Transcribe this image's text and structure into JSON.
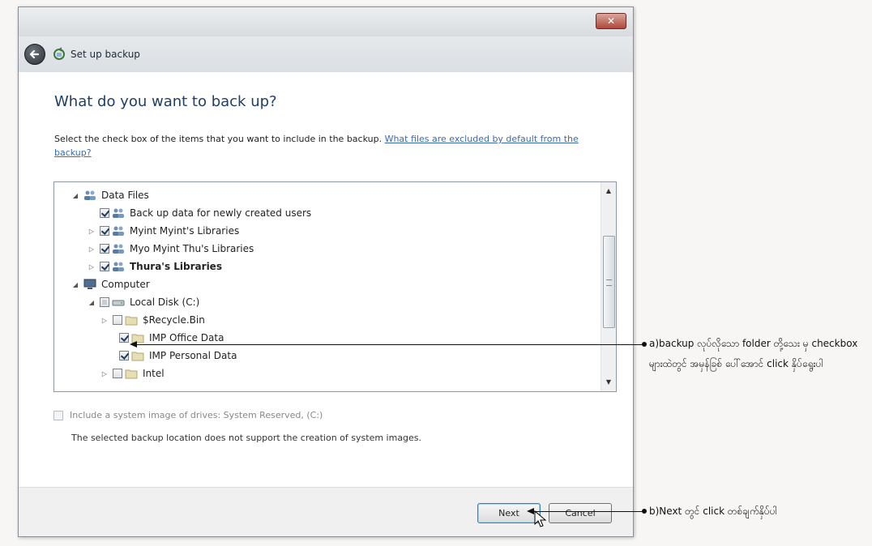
{
  "window": {
    "title": "Set up backup",
    "close_label": "✕"
  },
  "page": {
    "heading": "What do you want to back up?",
    "instructions": "Select the check box of the items that you want to include in the backup.",
    "help_link": "What files are excluded by default from the backup?"
  },
  "tree": {
    "items": [
      {
        "label": "Data Files",
        "expander": "◢",
        "checkbox": "none",
        "icon": "users-icon",
        "bold": false
      },
      {
        "label": "Back up data for newly created users",
        "expander": "",
        "checkbox": "checked",
        "icon": "users-icon",
        "bold": false
      },
      {
        "label": "Myint Myint's Libraries",
        "expander": "▷",
        "checkbox": "checked",
        "icon": "users-icon",
        "bold": false
      },
      {
        "label": "Myo Myint Thu's Libraries",
        "expander": "▷",
        "checkbox": "checked",
        "icon": "users-icon",
        "bold": false
      },
      {
        "label": "Thura's Libraries",
        "expander": "▷",
        "checkbox": "checked",
        "icon": "users-icon",
        "bold": true
      },
      {
        "label": "Computer",
        "expander": "◢",
        "checkbox": "none",
        "icon": "computer-icon",
        "bold": false
      },
      {
        "label": "Local Disk (C:)",
        "expander": "◢",
        "checkbox": "partial",
        "icon": "drive-icon",
        "bold": false
      },
      {
        "label": "$Recycle.Bin",
        "expander": "▷",
        "checkbox": "unchecked",
        "icon": "folder-icon",
        "bold": false
      },
      {
        "label": "IMP Office Data",
        "expander": "",
        "checkbox": "checked",
        "icon": "folder-icon",
        "bold": false
      },
      {
        "label": "IMP Personal Data",
        "expander": "",
        "checkbox": "checked",
        "icon": "folder-icon",
        "bold": false
      },
      {
        "label": "Intel",
        "expander": "▷",
        "checkbox": "unchecked",
        "icon": "folder-icon",
        "bold": false
      }
    ]
  },
  "system_image": {
    "label": "Include a system image of drives: System Reserved, (C:)",
    "note": "The selected backup location does not support the creation of system images."
  },
  "buttons": {
    "next": "Next",
    "cancel": "Cancel"
  },
  "annotations": {
    "a": "a)backup လုပ်လိုသော folder တို့သေး မှ checkbox များထဲတွင် အမှန်ခြစ် ပေါ်အောင် click နှိပ်ရွေးပါ",
    "b": "b)Next တွင် click တစ်ချက်နှိပ်ပါ"
  }
}
